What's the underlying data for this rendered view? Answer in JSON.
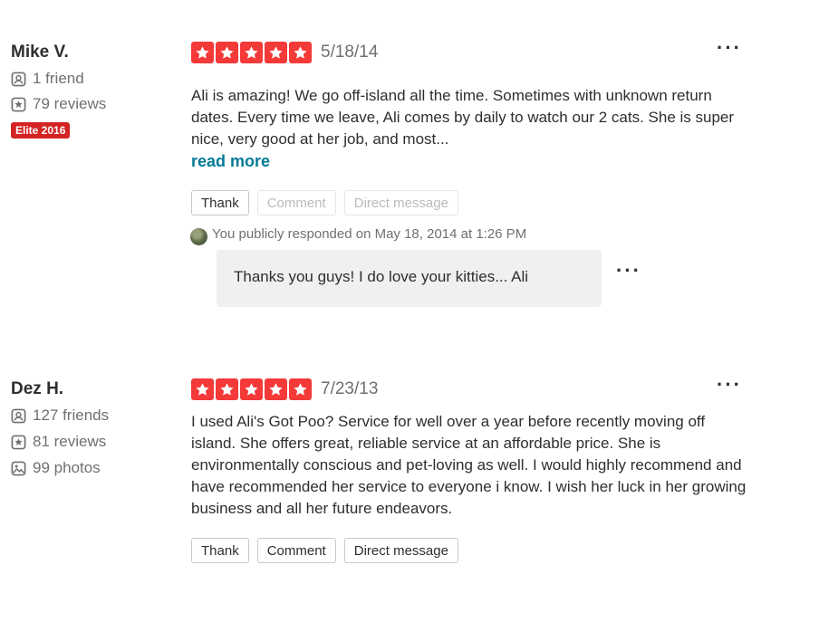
{
  "reviews": [
    {
      "user": {
        "name": "Mike V.",
        "friends": "1 friend",
        "reviews": "79 reviews",
        "elite": "Elite 2016"
      },
      "rating": 5,
      "date": "5/18/14",
      "more_label": "···",
      "text": "Ali is amazing! We go off-island all the time. Sometimes with unknown return dates. Every time we leave, Ali comes by daily to watch our 2 cats. She is super nice, very good at her job, and most...",
      "read_more": "read more",
      "actions": {
        "thank": "Thank",
        "comment": "Comment",
        "message": "Direct message"
      },
      "response": {
        "header": "You publicly responded on May 18, 2014 at 1:26 PM",
        "text": "Thanks you guys! I do love your kitties... Ali",
        "more_label": "···"
      }
    },
    {
      "user": {
        "name": "Dez H.",
        "friends": "127 friends",
        "reviews": "81 reviews",
        "photos": "99 photos"
      },
      "rating": 5,
      "date": "7/23/13",
      "more_label": "···",
      "text": "I used Ali's Got Poo? Service for well over a year before recently moving off island. She offers great, reliable service at an affordable price. She is environmentally conscious and pet-loving as well. I would highly recommend and have recommended her service to everyone i know. I wish her luck in her growing business and all her future endeavors.",
      "actions": {
        "thank": "Thank",
        "comment": "Comment",
        "message": "Direct message"
      }
    }
  ],
  "colors": {
    "star": "#f43939",
    "elite": "#d32323",
    "link": "#027a97"
  }
}
